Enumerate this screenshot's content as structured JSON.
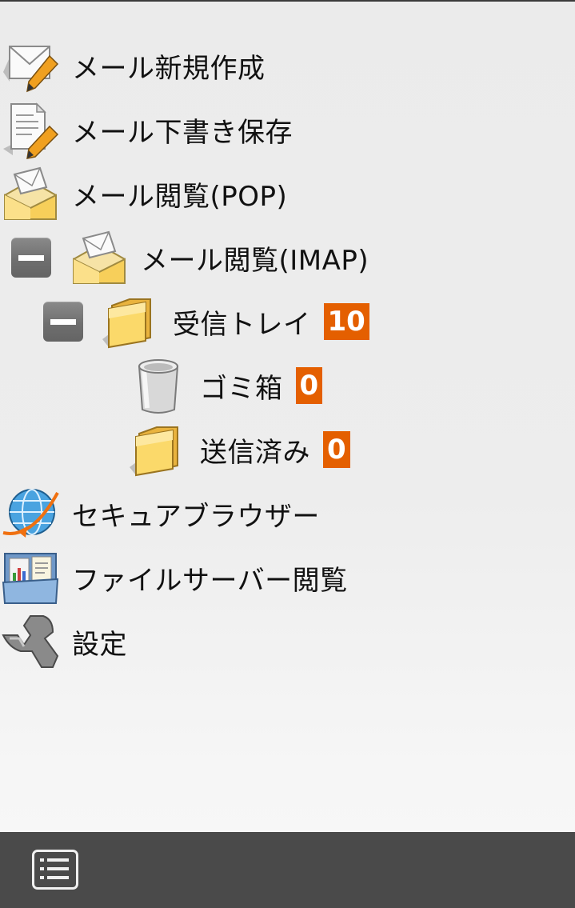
{
  "menu": {
    "compose": "メール新規作成",
    "draft": "メール下書き保存",
    "pop": "メール閲覧(POP)",
    "imap": "メール閲覧(IMAP)",
    "inbox": "受信トレイ",
    "inbox_count": "10",
    "trash": "ゴミ箱",
    "trash_count": "0",
    "sent": "送信済み",
    "sent_count": "0",
    "browser": "セキュアブラウザー",
    "fileserver": "ファイルサーバー閲覧",
    "settings": "設定"
  },
  "icons": {
    "compose": "envelope-pencil-icon",
    "draft": "document-pencil-icon",
    "pop": "mail-tray-icon",
    "imap": "mail-tray-icon",
    "imap_toggle": "collapse-minus-icon",
    "inbox_toggle": "collapse-minus-icon",
    "inbox": "folder-icon",
    "trash": "trash-can-icon",
    "sent": "folder-icon",
    "browser": "globe-icon",
    "fileserver": "file-folder-icon",
    "settings": "wrench-icon",
    "bottom": "list-menu-icon"
  },
  "colors": {
    "badge": "#e45f00",
    "bottom_bar": "#4a4a4a",
    "toggle": "#777777"
  }
}
